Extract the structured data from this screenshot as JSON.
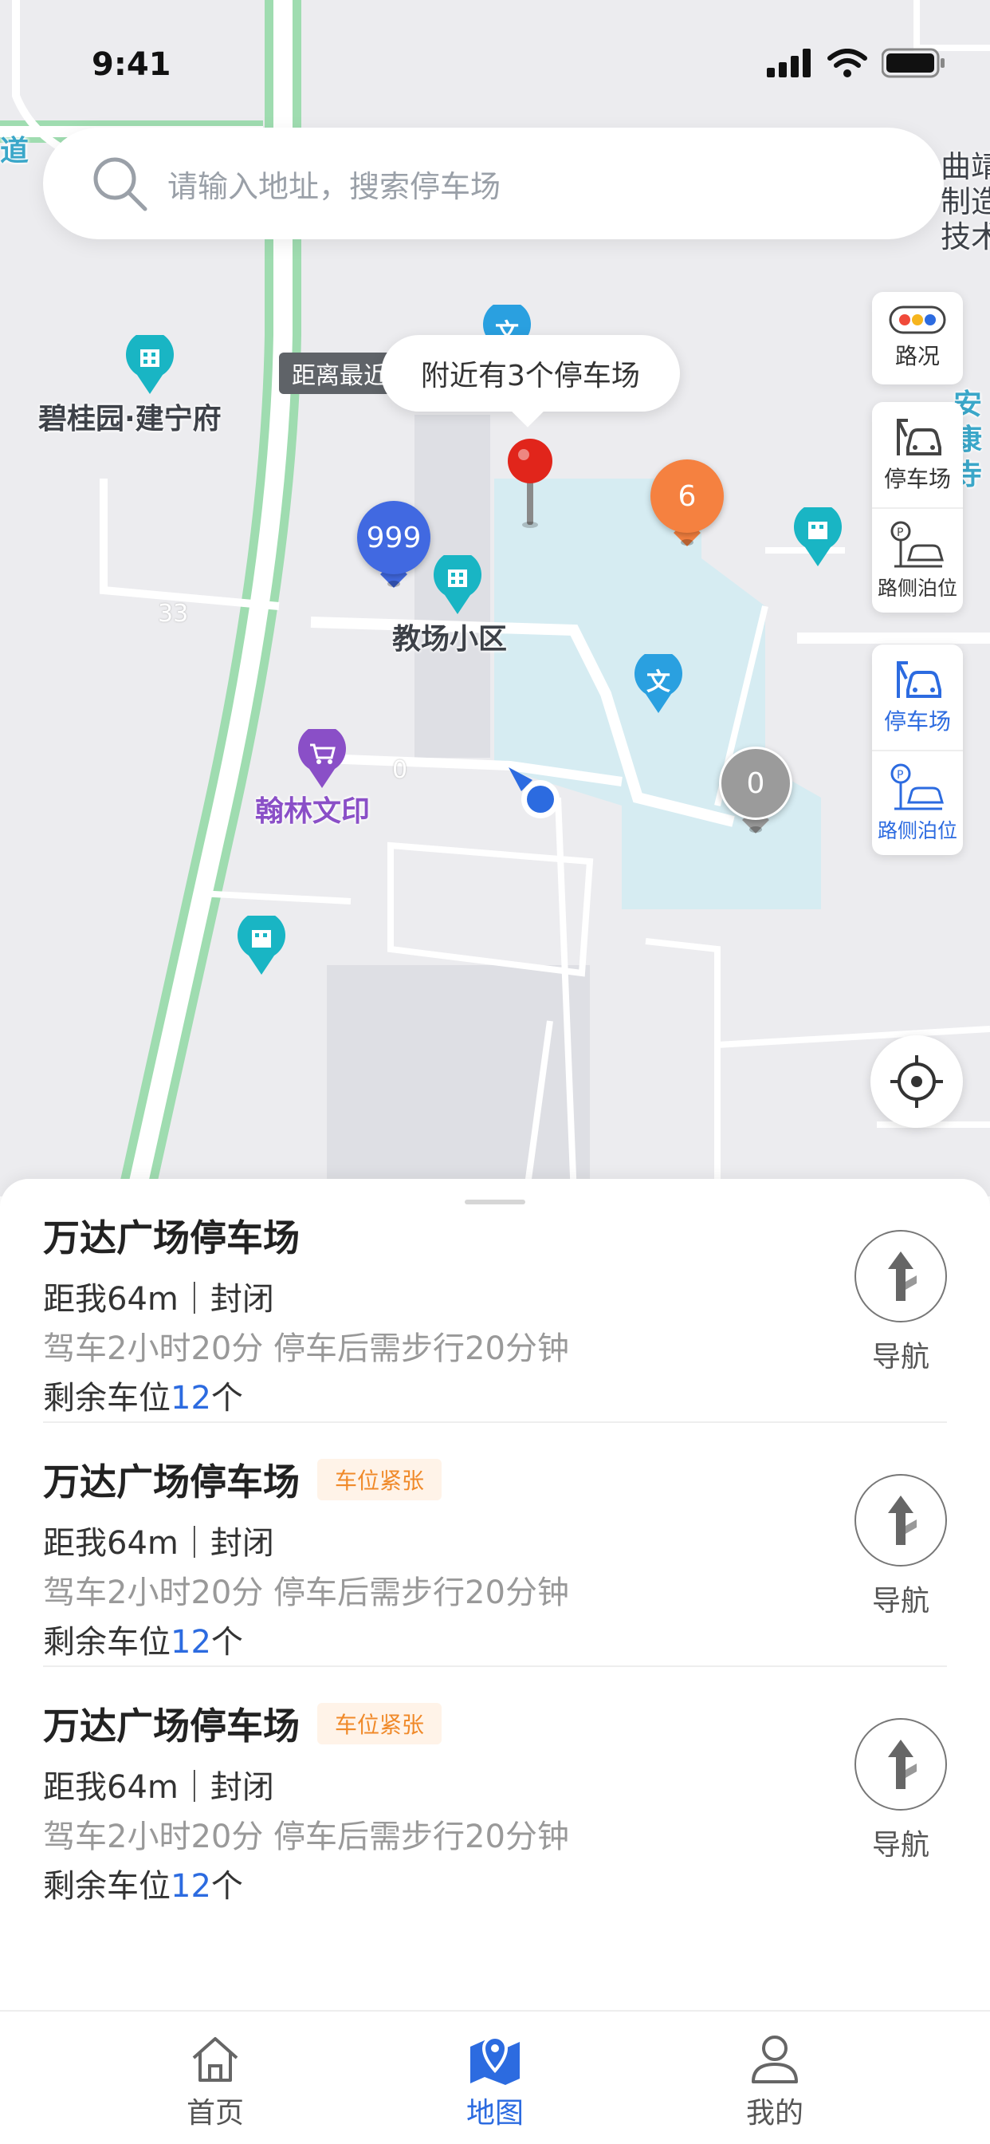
{
  "status_bar": {
    "time": "9:41"
  },
  "search": {
    "placeholder": "请输入地址，搜索停车场"
  },
  "map": {
    "tooltip": "附近有3个停车场",
    "distance_tag": "距离最近",
    "labels": {
      "residence_1": "碧桂园·建宁府",
      "residence_2": "教场小区",
      "shop": "翰林文印",
      "right_edge_1": "曲靖",
      "right_edge_2": "制造",
      "right_edge_3": "技术",
      "right_edge_4": "安",
      "right_edge_5": "康",
      "right_edge_6": "寺",
      "left_edge": "道",
      "road_num_1": "33",
      "road_num_2": "0",
      "edu_glyph": "文"
    },
    "clusters": [
      {
        "count": "999",
        "color": "#4169e1"
      },
      {
        "count": "6",
        "color": "#f58140"
      },
      {
        "count": "0",
        "color": "#9b9b9b"
      }
    ],
    "tools": {
      "traffic": "路况",
      "parking_lot": "停车场",
      "roadside": "路侧泊位",
      "parking_lot_active": "停车场",
      "roadside_active": "路侧泊位"
    }
  },
  "parking_list": [
    {
      "name": "万达广场停车场",
      "tag": "",
      "distance": "距我64m｜封闭",
      "route": "驾车2小时20分 停车后需步行20分钟",
      "remaining_prefix": "剩余车位",
      "remaining_count": "12",
      "remaining_suffix": "个",
      "nav_label": "导航"
    },
    {
      "name": "万达广场停车场",
      "tag": "车位紧张",
      "distance": "距我64m｜封闭",
      "route": "驾车2小时20分 停车后需步行20分钟",
      "remaining_prefix": "剩余车位",
      "remaining_count": "12",
      "remaining_suffix": "个",
      "nav_label": "导航"
    },
    {
      "name": "万达广场停车场",
      "tag": "车位紧张",
      "distance": "距我64m｜封闭",
      "route": "驾车2小时20分 停车后需步行20分钟",
      "remaining_prefix": "剩余车位",
      "remaining_count": "12",
      "remaining_suffix": "个",
      "nav_label": "导航"
    }
  ],
  "tabbar": {
    "home": "首页",
    "map": "地图",
    "mine": "我的",
    "active": "map"
  },
  "colors": {
    "accent": "#2c6be0",
    "warning": "#f08a2a",
    "map_bg": "#ececef",
    "water": "#d6ecf2",
    "road_green": "#9fdcb0"
  }
}
